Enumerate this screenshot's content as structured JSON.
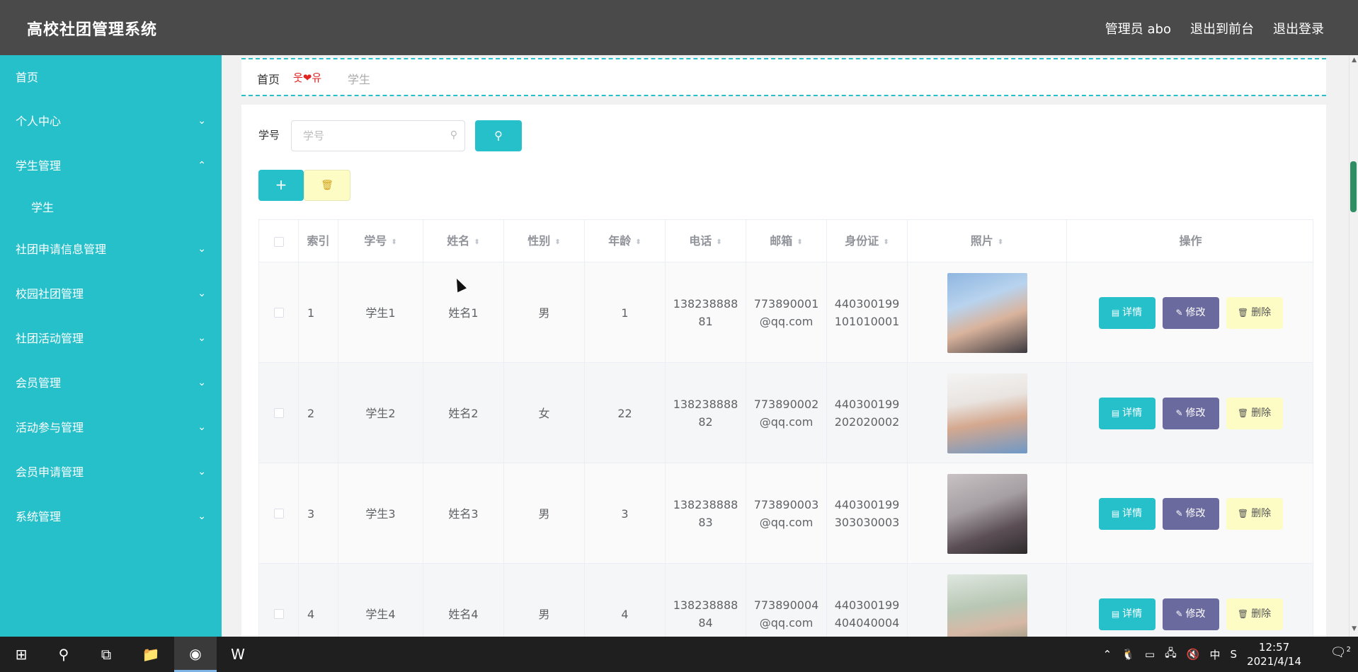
{
  "header": {
    "app_title": "高校社团管理系统",
    "admin_label": "管理员 abo",
    "exit_front_label": "退出到前台",
    "logout_label": "退出登录"
  },
  "sidebar": {
    "items": [
      {
        "label": "首页",
        "expanded": false
      },
      {
        "label": "个人中心",
        "expanded": false
      },
      {
        "label": "学生管理",
        "expanded": true
      },
      {
        "label": "学生",
        "sub": true
      },
      {
        "label": "社团申请信息管理",
        "expanded": false
      },
      {
        "label": "校园社团管理",
        "expanded": false
      },
      {
        "label": "社团活动管理",
        "expanded": false
      },
      {
        "label": "会员管理",
        "expanded": false
      },
      {
        "label": "活动参与管理",
        "expanded": false
      },
      {
        "label": "会员申请管理",
        "expanded": false
      },
      {
        "label": "系统管理",
        "expanded": false
      }
    ]
  },
  "breadcrumb": {
    "home": "首页",
    "separator": "웃❤유",
    "current": "学生"
  },
  "search": {
    "label": "学号",
    "placeholder": "学号"
  },
  "table": {
    "headers": {
      "index": "索引",
      "student_no": "学号",
      "name": "姓名",
      "gender": "性别",
      "age": "年龄",
      "phone": "电话",
      "email": "邮箱",
      "id_card": "身份证",
      "photo": "照片",
      "actions": "操作"
    },
    "rows": [
      {
        "index": "1",
        "student_no": "学生1",
        "name": "姓名1",
        "gender": "男",
        "age": "1",
        "phone": "138238888\n81",
        "email": "773890001\n@qq.com",
        "id_card": "440300199\n101010001"
      },
      {
        "index": "2",
        "student_no": "学生2",
        "name": "姓名2",
        "gender": "女",
        "age": "22",
        "phone": "138238888\n82",
        "email": "773890002\n@qq.com",
        "id_card": "440300199\n202020002"
      },
      {
        "index": "3",
        "student_no": "学生3",
        "name": "姓名3",
        "gender": "男",
        "age": "3",
        "phone": "138238888\n83",
        "email": "773890003\n@qq.com",
        "id_card": "440300199\n303030003"
      },
      {
        "index": "4",
        "student_no": "学生4",
        "name": "姓名4",
        "gender": "男",
        "age": "4",
        "phone": "138238888\n84",
        "email": "773890004\n@qq.com",
        "id_card": "440300199\n404040004"
      }
    ],
    "actions": {
      "detail": "详情",
      "edit": "修改",
      "delete": "删除"
    }
  },
  "taskbar": {
    "time": "12:57",
    "date": "2021/4/14",
    "ime": "中",
    "notifications": "2"
  },
  "colors": {
    "accent": "#26c0cb",
    "header_bg": "#4a4a4a",
    "edit_button": "#6a6a9f",
    "delete_button": "#fcfcc4"
  }
}
